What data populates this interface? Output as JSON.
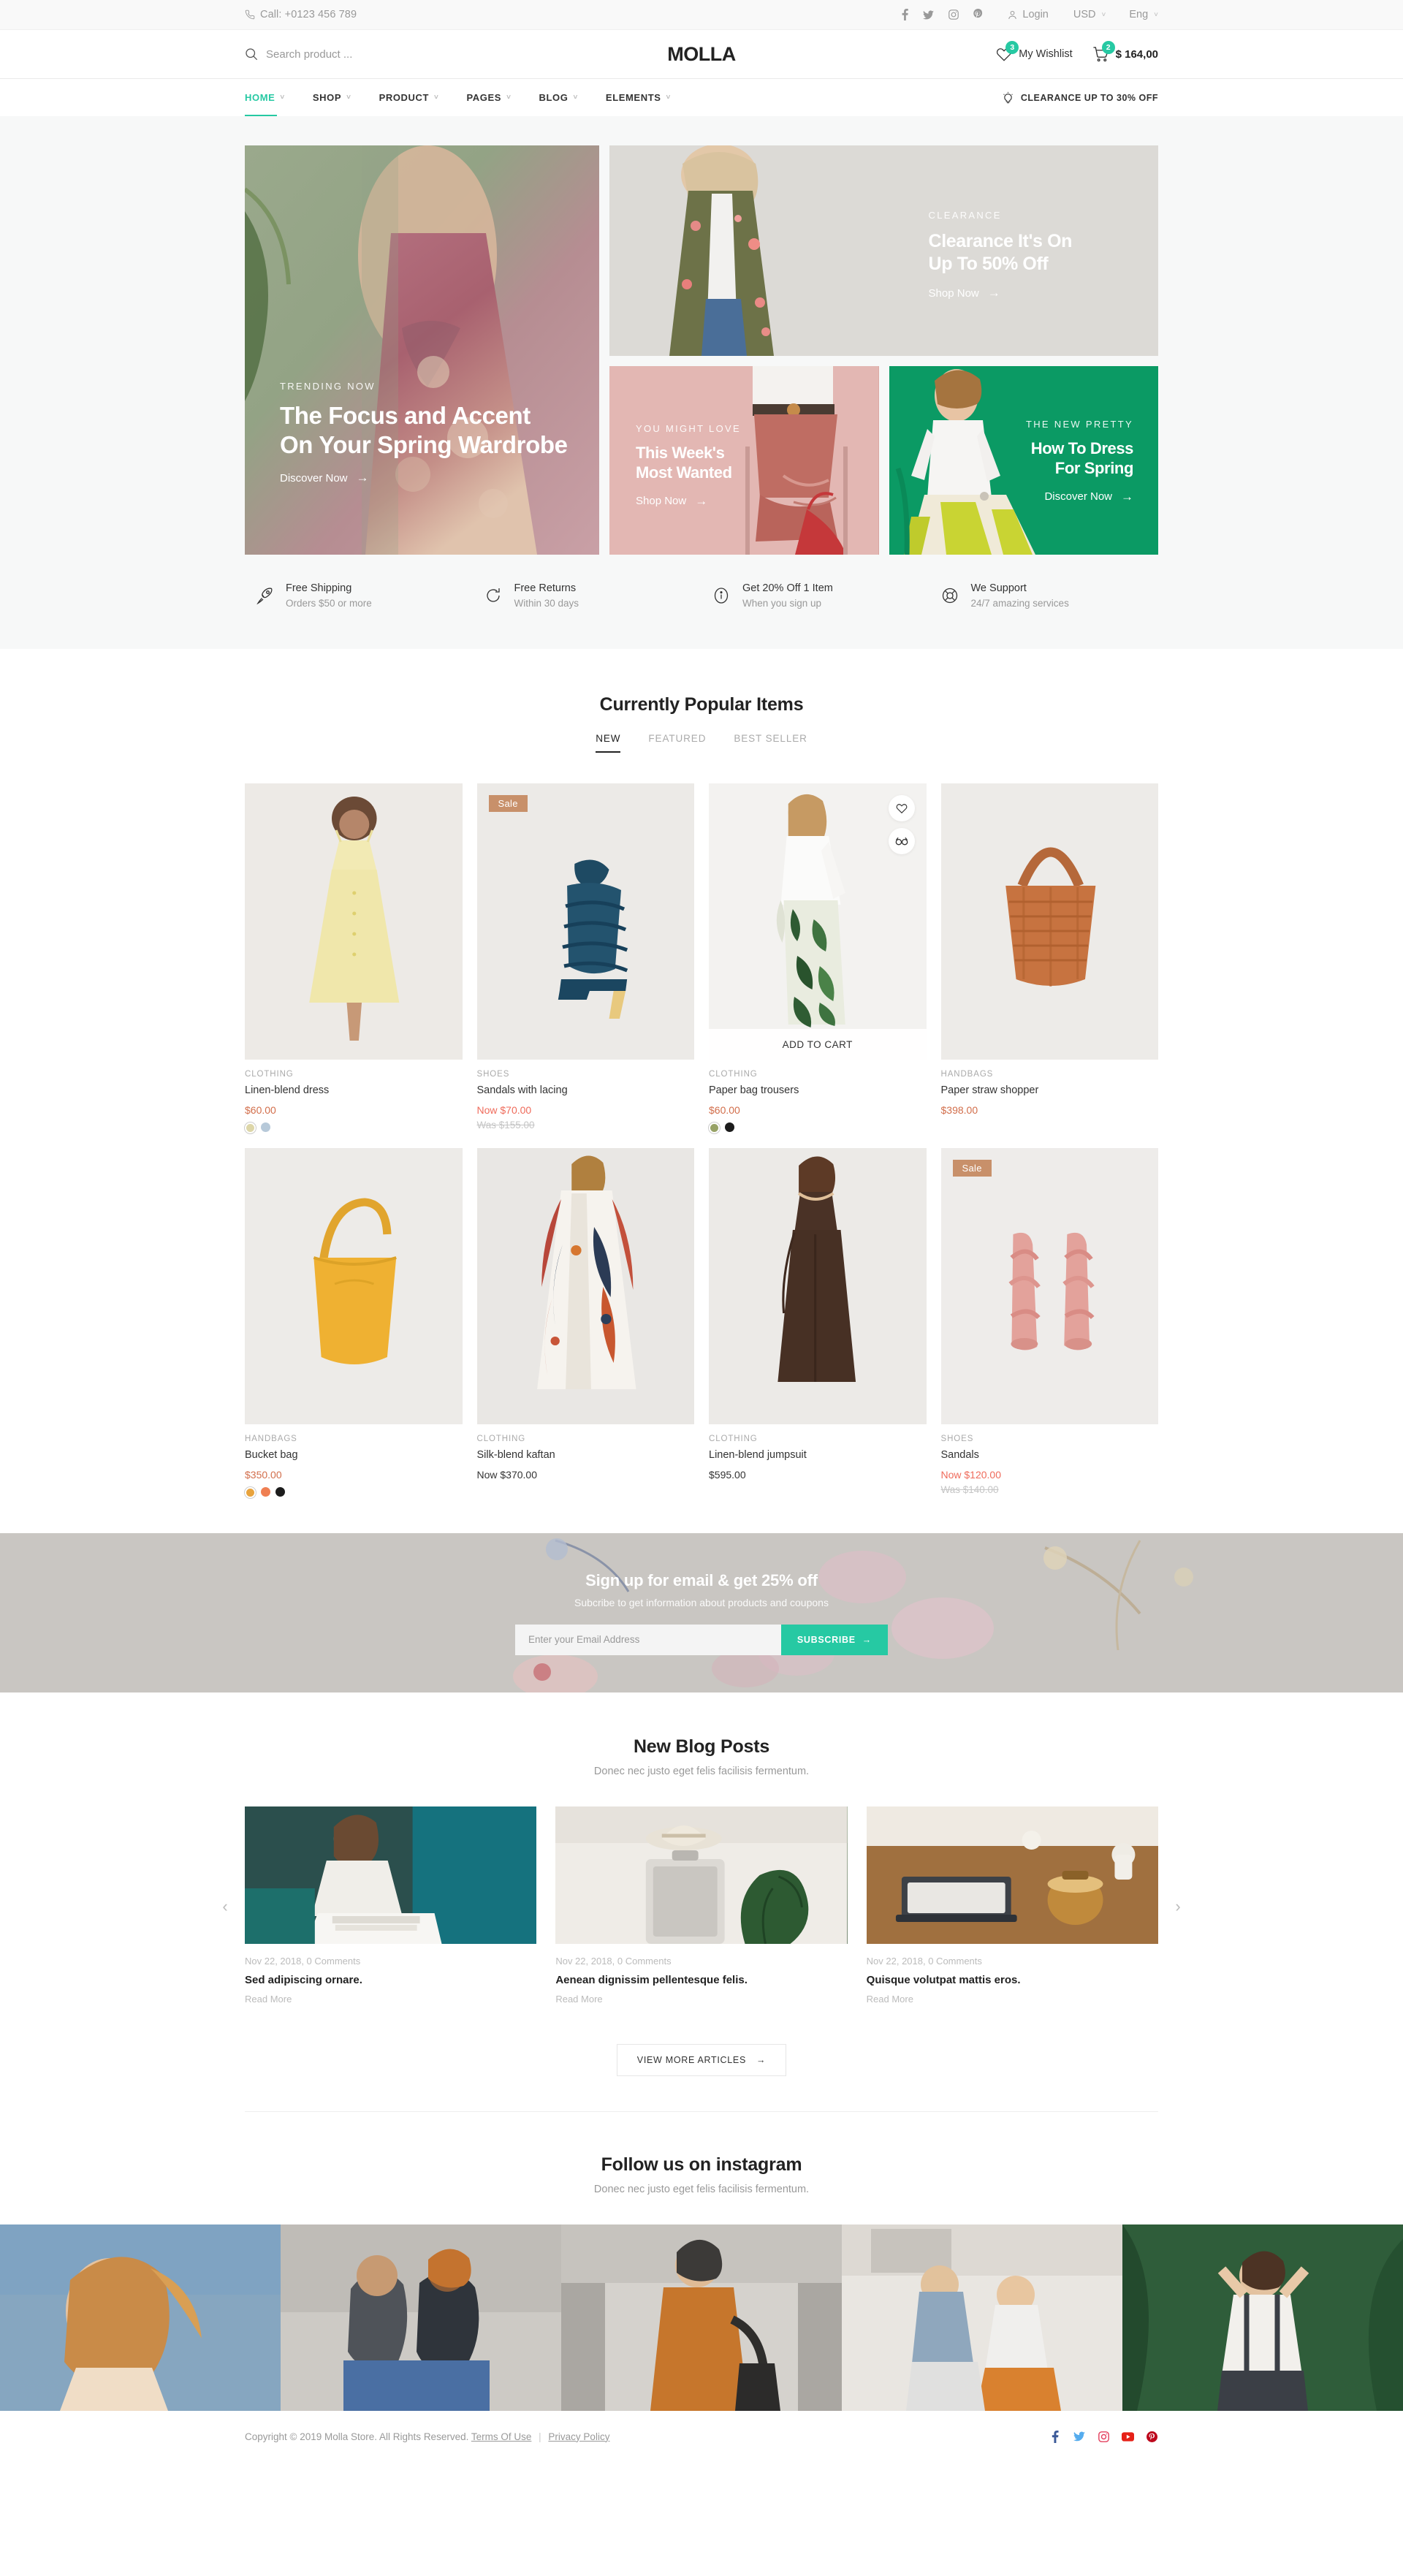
{
  "topbar": {
    "phone": "Call: +0123 456 789",
    "phone_icon": "phone-icon",
    "social": [
      {
        "name": "facebook-icon",
        "label": "f"
      },
      {
        "name": "twitter-icon",
        "label": "t"
      },
      {
        "name": "instagram-icon",
        "label": "i"
      },
      {
        "name": "pinterest-icon",
        "label": "p"
      }
    ],
    "login": "Login",
    "currency": "USD",
    "language": "Eng"
  },
  "header": {
    "search_placeholder": "Search product ...",
    "search_value": "",
    "logo": "MOLLA",
    "wishlist_label": "My Wishlist",
    "wishlist_count": "3",
    "cart_count": "2",
    "cart_total": "$ 164,00"
  },
  "nav": {
    "items": [
      {
        "label": "HOME",
        "active": true,
        "has_caret": true
      },
      {
        "label": "SHOP",
        "active": false,
        "has_caret": true
      },
      {
        "label": "PRODUCT",
        "active": false,
        "has_caret": true
      },
      {
        "label": "PAGES",
        "active": false,
        "has_caret": true
      },
      {
        "label": "BLOG",
        "active": false,
        "has_caret": true
      },
      {
        "label": "ELEMENTS",
        "active": false,
        "has_caret": true
      }
    ],
    "promo": "CLEARANCE UP TO 30% OFF"
  },
  "hero": {
    "main": {
      "subtitle": "TRENDING NOW",
      "title_line1": "The Focus and Accent",
      "title_line2": "On Your Spring Wardrobe",
      "cta": "Discover Now"
    },
    "clearance": {
      "subtitle": "CLEARANCE",
      "title_line1": "Clearance It's On",
      "title_line2": "Up To 50% Off",
      "cta": "Shop Now"
    },
    "most_wanted": {
      "subtitle": "YOU MIGHT LOVE",
      "title_line1": "This Week's",
      "title_line2": "Most Wanted",
      "cta": "Shop Now"
    },
    "spring": {
      "subtitle": "THE NEW PRETTY",
      "title_line1": "How To Dress",
      "title_line2": "For Spring",
      "cta": "Discover Now"
    }
  },
  "features": [
    {
      "icon": "rocket-icon",
      "title": "Free Shipping",
      "desc": "Orders $50 or more"
    },
    {
      "icon": "refresh-icon",
      "title": "Free Returns",
      "desc": "Within 30 days"
    },
    {
      "icon": "info-icon",
      "title": "Get 20% Off 1 Item",
      "desc": "When you sign up"
    },
    {
      "icon": "lifebuoy-icon",
      "title": "We Support",
      "desc": "24/7 amazing services"
    }
  ],
  "products": {
    "title": "Currently Popular Items",
    "tabs": [
      {
        "label": "NEW",
        "active": true
      },
      {
        "label": "FEATURED",
        "active": false
      },
      {
        "label": "BEST SELLER",
        "active": false
      }
    ],
    "items": [
      {
        "category": "CLOTHING",
        "name": "Linen-blend dress",
        "price": "$60.00",
        "was": null,
        "badge": null,
        "hover": false,
        "swatches": [
          "#ddd6a8",
          "#b7c9d9"
        ]
      },
      {
        "category": "SHOES",
        "name": "Sandals with lacing",
        "price": "Now $70.00",
        "was": "Was $155.00",
        "badge": "Sale",
        "hover": false,
        "swatches": []
      },
      {
        "category": "CLOTHING",
        "name": "Paper bag trousers",
        "price": "$60.00",
        "was": null,
        "badge": null,
        "hover": true,
        "add_to_cart": "ADD TO CART",
        "swatches": [
          "#97a266",
          "#1c1c1c"
        ]
      },
      {
        "category": "HANDBAGS",
        "name": "Paper straw shopper",
        "price": "$398.00",
        "was": null,
        "badge": null,
        "hover": false,
        "swatches": []
      },
      {
        "category": "HANDBAGS",
        "name": "Bucket bag",
        "price": "$350.00",
        "was": null,
        "badge": null,
        "hover": false,
        "swatches": [
          "#e8a33d",
          "#ef7f52",
          "#1c1c1c"
        ]
      },
      {
        "category": "CLOTHING",
        "name": "Silk-blend kaftan",
        "price": "Now $370.00",
        "was": null,
        "badge": null,
        "hover": false,
        "swatches": []
      },
      {
        "category": "CLOTHING",
        "name": "Linen-blend jumpsuit",
        "price": "$595.00",
        "was": null,
        "badge": null,
        "hover": false,
        "swatches": []
      },
      {
        "category": "SHOES",
        "name": "Sandals",
        "price": "Now $120.00",
        "was": "Was $140.00",
        "badge": "Sale",
        "hover": false,
        "swatches": []
      }
    ]
  },
  "newsletter": {
    "title": "Sign up for email & get 25% off",
    "subtitle": "Subcribe to get information about products and coupons",
    "placeholder": "Enter your Email Address",
    "input_value": "",
    "button": "SUBSCRIBE"
  },
  "blog": {
    "title": "New Blog Posts",
    "subtitle": "Donec nec justo eget felis facilisis fermentum.",
    "posts": [
      {
        "meta": "Nov 22, 2018, 0 Comments",
        "title": "Sed adipiscing ornare.",
        "read": "Read More"
      },
      {
        "meta": "Nov 22, 2018, 0 Comments",
        "title": "Aenean dignissim pellentesque felis.",
        "read": "Read More"
      },
      {
        "meta": "Nov 22, 2018, 0 Comments",
        "title": "Quisque volutpat mattis eros.",
        "read": "Read More"
      }
    ],
    "view_more": "VIEW MORE ARTICLES"
  },
  "instagram": {
    "title": "Follow us on instagram",
    "subtitle": "Donec nec justo eget felis facilisis fermentum."
  },
  "footer": {
    "copyright": "Copyright © 2019 Molla Store. All Rights Reserved.",
    "terms": "Terms Of Use",
    "privacy": "Privacy Policy",
    "social": [
      "facebook-icon",
      "twitter-icon",
      "instagram-icon",
      "youtube-icon",
      "pinterest-icon"
    ]
  },
  "colors": {
    "accent": "#26c9a3",
    "sale_badge": "#c8906a",
    "price": "#d26e4b",
    "sale_price": "#ef6b5b"
  }
}
